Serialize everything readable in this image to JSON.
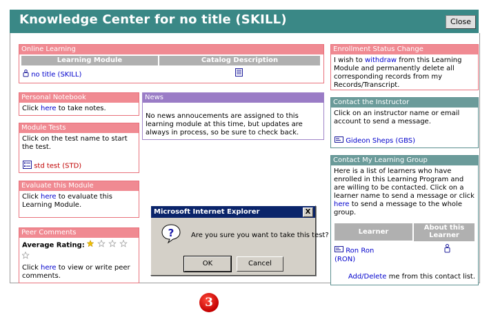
{
  "header": {
    "title": "Knowledge Center for no title (SKILL)",
    "close_label": "Close"
  },
  "online_learning": {
    "title": "Online Learning",
    "col_module": "Learning Module",
    "col_catalog": "Catalog Description",
    "module_link": "no title (SKILL)"
  },
  "notebook": {
    "title": "Personal Notebook",
    "pre": "Click ",
    "link": "here",
    "post": " to take notes."
  },
  "news": {
    "title": "News",
    "body": "No news annoucements are assigned to this learning module at this time, but updates are always in process, so be sure to check back."
  },
  "tests": {
    "title": "Module Tests",
    "body": "Click on the test name to start the test.",
    "test_link": "std test (STD)"
  },
  "evaluate": {
    "title": "Evaluate this Module",
    "pre": "Click ",
    "link": "here",
    "post": " to evaluate this Learning Module."
  },
  "peer": {
    "title": "Peer Comments",
    "rating_label": "Average Rating:",
    "pre": "Click ",
    "link": "here",
    "post": " to view or write peer comments."
  },
  "enrollment": {
    "title": "Enrollment Status Change",
    "pre": "I wish to ",
    "link": "withdraw",
    "post": " from this Learning Module and permanently delete all corresponding records from my Records/Transcript."
  },
  "instructor": {
    "title": "Contact the Instructor",
    "body": "Click on an instructor name or email account to send a message.",
    "name": "Gideon Sheps (GBS)"
  },
  "group": {
    "title": "Contact My Learning Group",
    "pre": "Here is a list of learners who have enrolled in this Learning Program and are willing to be contacted. Click on a learner name to send a message or click ",
    "link": "here",
    "post": " to send a message to the whole group.",
    "col_learner": "Learner",
    "col_about": "About this Learner",
    "learner_name": "Ron Ron",
    "learner_code": "(RON)",
    "add_delete": "Add/Delete",
    "add_delete_post": " me from this contact list."
  },
  "dialog": {
    "title": "Microsoft Internet Explorer",
    "close": "X",
    "message": "Are you sure you want to take this test?",
    "ok": "OK",
    "cancel": "Cancel"
  },
  "badge": {
    "number": "3"
  },
  "colors": {
    "header": "#3a8886",
    "pink": "#f08a92",
    "teal": "#6b9b9a",
    "purple": "#9a7cc6",
    "dialog_title": "#0a246a",
    "badge": "#c40000"
  }
}
